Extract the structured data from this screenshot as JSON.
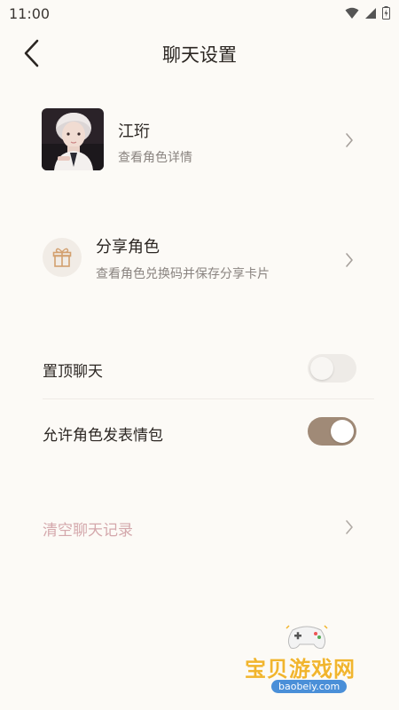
{
  "status": {
    "time": "11:00"
  },
  "header": {
    "title": "聊天设置"
  },
  "character": {
    "name": "江珩",
    "subtitle": "查看角色详情"
  },
  "share": {
    "title": "分享角色",
    "subtitle": "查看角色兑换码并保存分享卡片"
  },
  "settings": [
    {
      "label": "置顶聊天",
      "enabled": false
    },
    {
      "label": "允许角色发表情包",
      "enabled": true
    }
  ],
  "clear": {
    "label": "清空聊天记录"
  },
  "watermark": {
    "text": "宝贝游戏网",
    "url": "baobeiy.com"
  },
  "colors": {
    "accent": "#a08a77",
    "danger_text": "#d4a8ac",
    "background": "#fcfaf6"
  }
}
